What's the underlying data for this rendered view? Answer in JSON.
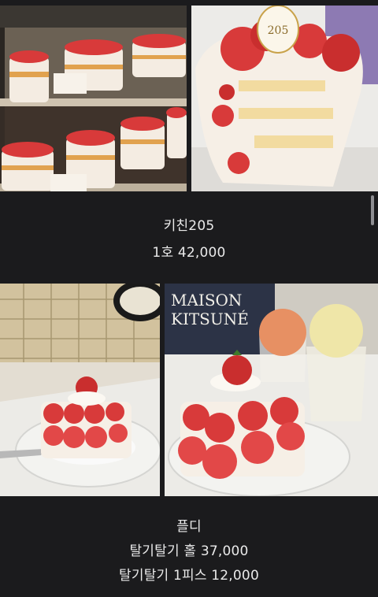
{
  "posts": [
    {
      "images": [
        {
          "name": "cake-display-case-photo",
          "description": "strawberry cakes in glass display case"
        },
        {
          "name": "strawberry-cake-slice-photo",
          "description": "sliced strawberry cream cake"
        }
      ],
      "lines": [
        "키친205",
        "1호 42,000"
      ]
    },
    {
      "images": [
        {
          "name": "strawberry-tower-cake-photo",
          "description": "strawberry tower cake on plate"
        },
        {
          "name": "strawberry-cake-with-ice-cream-photo",
          "description": "strawberry tower cake with ice cream"
        }
      ],
      "lines": [
        "플디",
        "탈기탈기 홀 37,000",
        "탈기탈기 1피스 12,000"
      ]
    }
  ],
  "photo_text": {
    "cake_topper": "205",
    "cafe_sign_line1": "MAISON",
    "cafe_sign_line2": "KITSUNÉ"
  },
  "colors": {
    "background": "#1b1b1d",
    "text": "#eaeaea",
    "strawberry": "#d83a3a",
    "cream": "#f6efe6",
    "sponge": "#f2dba0"
  }
}
